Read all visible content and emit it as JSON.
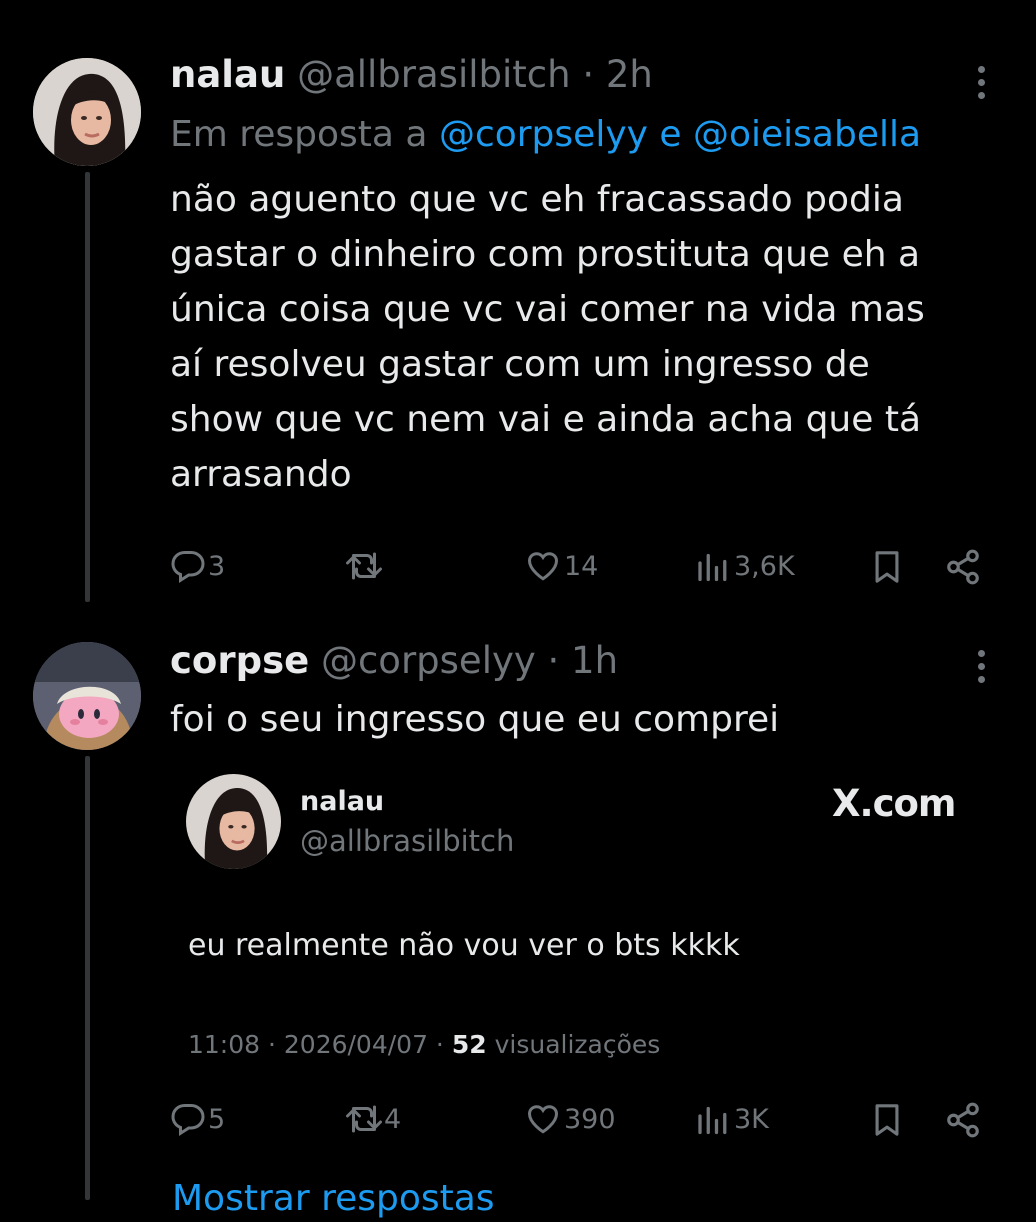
{
  "post1": {
    "display_name": "nalau",
    "handle": "@allbrasilbitch",
    "time": "· 2h",
    "reply_prefix": "Em resposta a",
    "reply_to_1": "@corpselyy",
    "reply_joiner": "e",
    "reply_to_2": "@oieisabella",
    "text_lines": [
      "não aguento que vc eh fracassado podia",
      "gastar o dinheiro com prostituta que eh a",
      "única coisa que vc vai comer na vida mas",
      "aí resolveu gastar com um ingresso de",
      "show que vc nem vai e ainda acha que tá",
      "arrasando"
    ],
    "replies": "3",
    "reposts": "",
    "likes": "14",
    "views": "3,6K"
  },
  "post2": {
    "display_name": "corpse",
    "handle": "@corpselyy",
    "time": "· 1h",
    "text": "foi o seu ingresso que eu comprei",
    "replies": "5",
    "reposts": "4",
    "likes": "390",
    "views": "3K",
    "embed": {
      "display_name": "nalau",
      "handle": "@allbrasilbitch",
      "brand": "X.com",
      "text": "eu realmente não vou ver o bts kkkk",
      "meta_time": "11:08 · 2026/04/07 ·",
      "meta_views_count": "52",
      "meta_views_label": "visualizações"
    }
  },
  "show_replies": "Mostrar respostas",
  "colors": {
    "background": "#000000",
    "text": "#e7e9ea",
    "muted": "#71767b",
    "link": "#1d9bf0"
  }
}
